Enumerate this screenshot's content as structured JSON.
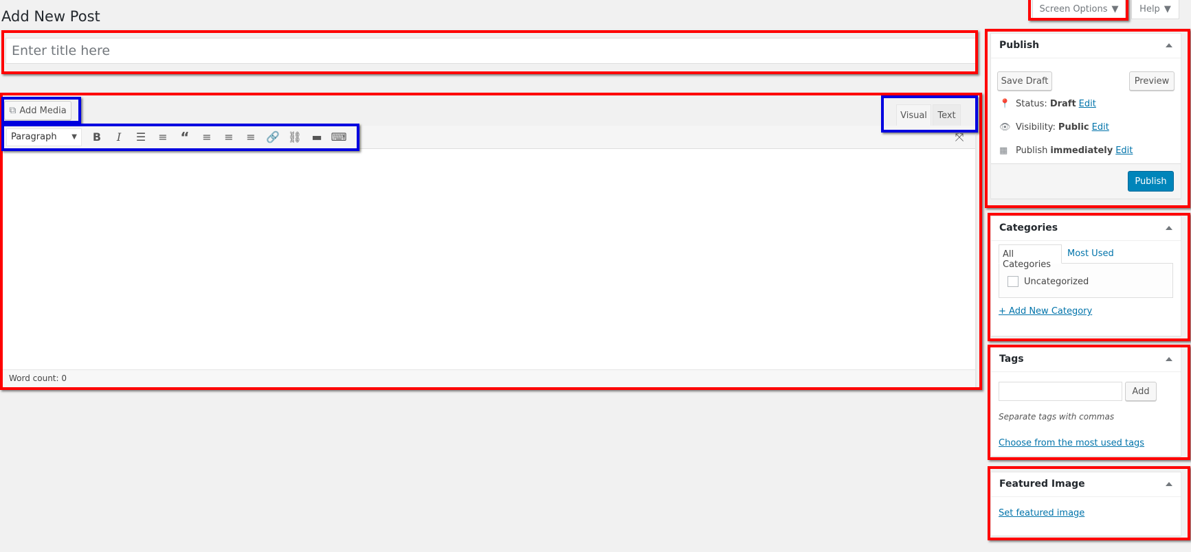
{
  "page": {
    "title": "Add New Post"
  },
  "top": {
    "screen_options": "Screen Options",
    "help": "Help"
  },
  "post": {
    "title_placeholder": "Enter title here",
    "title_value": ""
  },
  "editor": {
    "add_media": "Add Media",
    "format_select": "Paragraph",
    "tabs": {
      "visual": "Visual",
      "text": "Text"
    },
    "active_tab": "Visual",
    "toolbar_icons": [
      "bold-icon",
      "italic-icon",
      "bulleted-list-icon",
      "numbered-list-icon",
      "blockquote-icon",
      "align-left-icon",
      "align-center-icon",
      "align-right-icon",
      "insert-link-icon",
      "remove-link-icon",
      "read-more-icon",
      "toolbar-toggle-icon"
    ],
    "word_count": "Word count: 0"
  },
  "publish": {
    "heading": "Publish",
    "save_draft": "Save Draft",
    "preview": "Preview",
    "status_label": "Status:",
    "status_value": "Draft",
    "visibility_label": "Visibility:",
    "visibility_value": "Public",
    "schedule_label": "Publish",
    "schedule_value": "immediately",
    "edit": "Edit",
    "publish_button": "Publish",
    "publish_color": "#0085ba"
  },
  "categories": {
    "heading": "Categories",
    "tabs": [
      "All Categories",
      "Most Used"
    ],
    "items": [
      {
        "label": "Uncategorized",
        "checked": false
      }
    ],
    "add_new": "+ Add New Category"
  },
  "tags": {
    "heading": "Tags",
    "input_value": "",
    "add": "Add",
    "help": "Separate tags with commas",
    "choose": "Choose from the most used tags"
  },
  "featured": {
    "heading": "Featured Image",
    "set": "Set featured image"
  }
}
